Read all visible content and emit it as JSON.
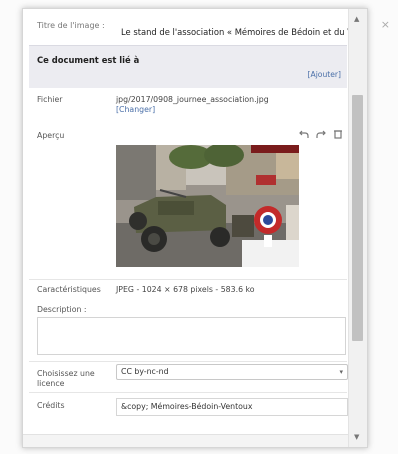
{
  "dialog": {
    "title_label": "Titre de l'image :",
    "title_value": "Le stand de l'association « Mémoires de Bédoin et du Ventoux »",
    "linked_heading": "Ce document est lié à",
    "add_link": "[Ajouter]"
  },
  "file": {
    "label": "Fichier",
    "path": "jpg/2017/0908_journee_association.jpg",
    "change_link": "[Changer]"
  },
  "preview": {
    "label": "Aperçu",
    "tools": [
      "rotate-left-icon",
      "rotate-right-icon",
      "delete-icon"
    ]
  },
  "characteristics": {
    "label": "Caractéristiques",
    "value": "JPEG - 1024 × 678 pixels - 583.6 ko"
  },
  "description": {
    "label": "Description :",
    "value": ""
  },
  "license": {
    "label": "Choisissez une licence",
    "selected": "CC by-nc-nd"
  },
  "credits": {
    "label": "Crédits",
    "value": "&copy; Mémoires-Bédoin-Ventoux"
  },
  "colors": {
    "link": "#4a6fa8",
    "section_bg": "#ececf1"
  }
}
